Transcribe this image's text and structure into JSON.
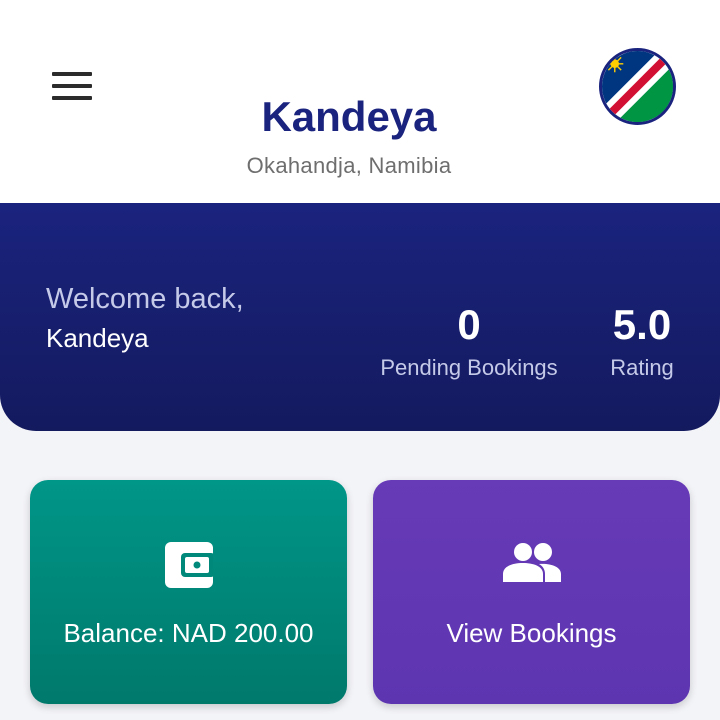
{
  "header": {
    "title": "Kandeya",
    "location": "Okahandja, Namibia",
    "menu_icon": "hamburger-menu-icon",
    "flag_icon": "namibia-flag-icon"
  },
  "banner": {
    "welcome": "Welcome back,",
    "name": "Kandeya",
    "stats": [
      {
        "value": "0",
        "label": "Pending Bookings"
      },
      {
        "value": "5.0",
        "label": "Rating"
      }
    ]
  },
  "cards": [
    {
      "label": "Balance: NAD 200.00",
      "icon": "wallet-icon",
      "color": "#009688"
    },
    {
      "label": "View Bookings",
      "icon": "people-icon",
      "color": "#673ab7"
    }
  ],
  "colors": {
    "primary": "#1a237e",
    "background": "#f3f4f8"
  }
}
